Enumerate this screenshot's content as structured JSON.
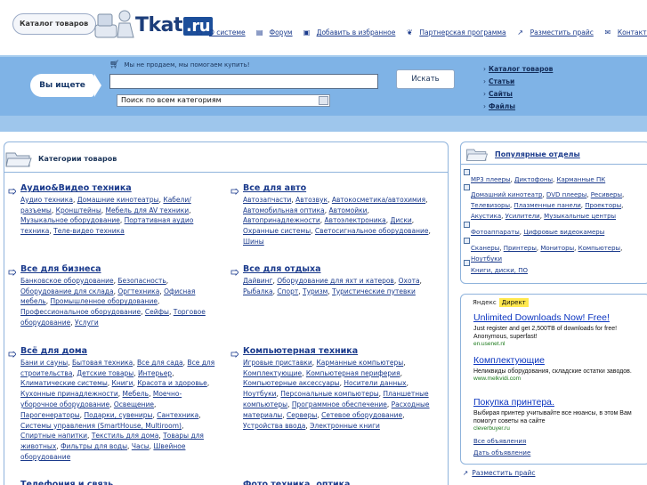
{
  "header": {
    "logo_pill": "Каталог товаров",
    "logo_text": "Tkat",
    "logo_ru": ".ru",
    "nav": [
      {
        "icon": "info-icon",
        "label": "О системе"
      },
      {
        "icon": "forum-icon",
        "label": "Форум"
      },
      {
        "icon": "bookmark-icon",
        "label": "Добавить в избранное"
      },
      {
        "icon": "partners-icon",
        "label": "Партнерская программа"
      },
      {
        "icon": "arrow-icon",
        "label": "Разместить прайс"
      },
      {
        "icon": "mail-icon",
        "label": "Контакты"
      }
    ]
  },
  "search": {
    "ask_label": "Вы ищете",
    "tagline": "Мы не продаем, мы помогаем купить!",
    "input_value": "",
    "button_label": "Искать",
    "category_selected": "Поиск по всем категориям",
    "quick_links": [
      "Каталог товаров",
      "Статьи",
      "Сайты",
      "Файлы"
    ]
  },
  "categories_panel": {
    "title": "Категории товаров",
    "categories": [
      {
        "title": "Аудио&Видео техника",
        "items": [
          "Аудио техника",
          "Домашние кинотеатры",
          "Кабели/разъемы",
          "Кронштейны",
          "Мебель для AV техники",
          "Музыкальное оборудование",
          "Портативная аудио техника",
          "Теле-видео техника"
        ]
      },
      {
        "title": "Все для авто",
        "items": [
          "Автозапчасти",
          "Автозвук",
          "Автокосметика/автохимия",
          "Автомобильная оптика",
          "Автомойки",
          "Автопринадлежности",
          "Автоэлектроника",
          "Диски",
          "Охранные системы",
          "Светосигнальное оборудование",
          "Шины"
        ]
      },
      {
        "title": "Все для бизнеса",
        "items": [
          "Банковское оборудование",
          "Безопасность",
          "Оборудование для склада",
          "Оргтехника",
          "Офисная мебель",
          "Промышленное оборудование",
          "Профессиональное оборудование",
          "Сейфы",
          "Торговое оборудование",
          "Услуги"
        ]
      },
      {
        "title": "Все для отдыха",
        "items": [
          "Дайвинг",
          "Оборудование для яхт и катеров",
          "Охота",
          "Рыбалка",
          "Спорт",
          "Туризм",
          "Туристические путевки"
        ]
      },
      {
        "title": "Всё для дома",
        "items": [
          "Бани и сауны",
          "Бытовая техника",
          "Все для сада",
          "Все для строительства",
          "Детские товары",
          "Интерьер",
          "Климатические системы",
          "Книги",
          "Красота и здоровье",
          "Кухонные принадлежности",
          "Мебель",
          "Моечно-уборочное оборудование",
          "Освещение",
          "Парогенераторы",
          "Подарки, сувениры",
          "Сантехника",
          "Системы управления (SmartHouse, Multiroom)",
          "Спиртные напитки",
          "Текстиль для дома",
          "Товары для животных",
          "Фильтры для воды",
          "Часы",
          "Швейное оборудование"
        ]
      },
      {
        "title": "Компьютерная техника",
        "items": [
          "Игровые приставки",
          "Карманные компьютеры",
          "Комплектующие",
          "Компьютерная периферия",
          "Компьютерные аксессуары",
          "Носители данных",
          "Ноутбуки",
          "Персональные компьютеры",
          "Планшетные компьютеры",
          "Программное обеспечение",
          "Расходные материалы",
          "Серверы",
          "Сетевое оборудование",
          "Устройства ввода",
          "Электронные книги"
        ]
      },
      {
        "title": "Телефония и связь",
        "items": []
      },
      {
        "title": "Фото техника, оптика",
        "items": []
      }
    ]
  },
  "popular": {
    "title": "Популярные отделы",
    "groups": [
      [
        "MP3 плееры",
        "Диктофоны",
        "Карманные ПК"
      ],
      [
        "Домашний кинотеатр",
        "DVD плееры",
        "Ресиверы",
        "Телевизоры",
        "Плазменные панели",
        "Проекторы",
        "Акустика",
        "Усилители",
        "Музыкальные центры"
      ],
      [
        "Фотоаппараты",
        "Цифровые видеокамеры"
      ],
      [
        "Сканеры",
        "Принтеры",
        "Мониторы",
        "Компьютеры",
        "Ноутбуки"
      ],
      [
        "Книги, диски, ПО"
      ]
    ]
  },
  "ads": {
    "brand": "Яндекс",
    "brand_badge": "Директ",
    "items": [
      {
        "title": "Unlimited Downloads Now! Free!",
        "body": "Just register and get 2,500TB of downloads for free! Anonymous, superfast!",
        "url": "en.usenet.nl"
      },
      {
        "title": "Комплектующие",
        "body": "Неликвиды оборудования, складские остатки заводов.",
        "url": "www.melkvidi.com"
      },
      {
        "title": "Покупка принтера.",
        "body": "Выбирая принтер учитывайте все нюансы, в этом Вам помогут советы на сайте",
        "url": "cleverbuyer.ru"
      }
    ],
    "all_label": "Все объявления",
    "give_label": "Дать объявление"
  },
  "place_price_label": "Разместить прайс",
  "colors": {
    "band": "#7fb3e6",
    "link": "#1a3a8c",
    "ad_title": "#0b35c0",
    "ad_url": "#1b7a1b",
    "panel_border": "#8fb3dc"
  }
}
